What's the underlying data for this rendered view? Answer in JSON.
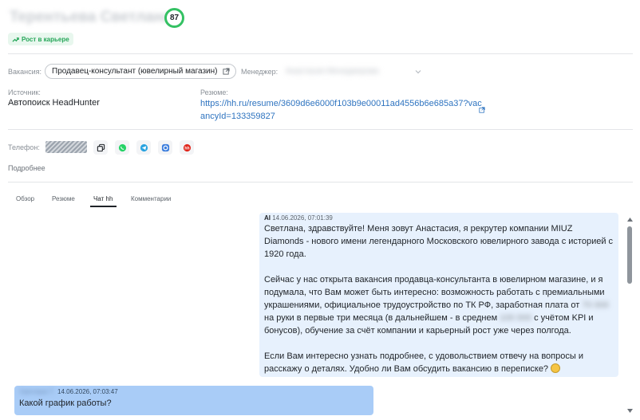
{
  "header": {
    "candidate_name": "Терентьева Светлана",
    "score": "87",
    "tag_label": "Рост в карьере"
  },
  "details": {
    "vacancy_label": "Вакансия:",
    "vacancy_value": "Продавец-консультант (ювелирный магазин)",
    "manager_label": "Менеджер:",
    "manager_value": "Анастасия Менеджерова",
    "source_label": "Источник:",
    "source_value": "Автопоиск HeadHunter",
    "resume_label": "Резюме:",
    "resume_link": "https://hh.ru/resume/3609d6e6000f103b9e00011ad4556b6e685a37?vacancyId=133359827",
    "phone_label": "Телефон:",
    "more_label": "Подробнее"
  },
  "contact_icons": [
    "copy-icon",
    "whatsapp-icon",
    "telegram-icon",
    "max-messenger-icon",
    "headhunter-icon"
  ],
  "tabs": [
    {
      "label": "Обзор",
      "active": false
    },
    {
      "label": "Резюме",
      "active": false
    },
    {
      "label": "Чат hh",
      "active": true
    },
    {
      "label": "Комментарии",
      "active": false
    }
  ],
  "chat": {
    "ai_message": {
      "author": "AI",
      "timestamp": "14.06.2026, 07:01:39",
      "p1": "Светлана, здравствуйте! Меня зовут Анастасия, я рекрутер компании MIUZ Diamonds - нового имени легендарного Московского ювелирного завода с историей с 1920 года.",
      "p2a": "Сейчас у нас открыта вакансия продавца-консультанта в ювелирном магазине, и я подумала, что Вам может быть интересно: возможность работать с премиальными украшениями, официальное трудоустройство по ТК РФ, заработная плата от",
      "salary_first": "70 000",
      "p2b": "на руки в первые три месяца (в дальнейшем - в среднем",
      "salary_avg": "100 000",
      "p2c": "с учётом KPI и бонусов), обучение за счёт компании и карьерный рост уже через полгода.",
      "p3": "Если Вам интересно узнать подробнее, с удовольствием отвечу на вопросы и расскажу о деталях. Удобно ли Вам обсудить вакансию в переписке?"
    },
    "user_message": {
      "author": "Светлана Т.",
      "timestamp": "14.06.2026, 07:03:47",
      "text": "Какой график работы?"
    }
  },
  "colors": {
    "score_ring": "#34c163",
    "tag_bg": "#e8f7ee",
    "tag_text": "#26a659",
    "link": "#2f74c0",
    "ai_bubble": "#e7f1fd",
    "user_bubble": "#a9ccf7"
  }
}
